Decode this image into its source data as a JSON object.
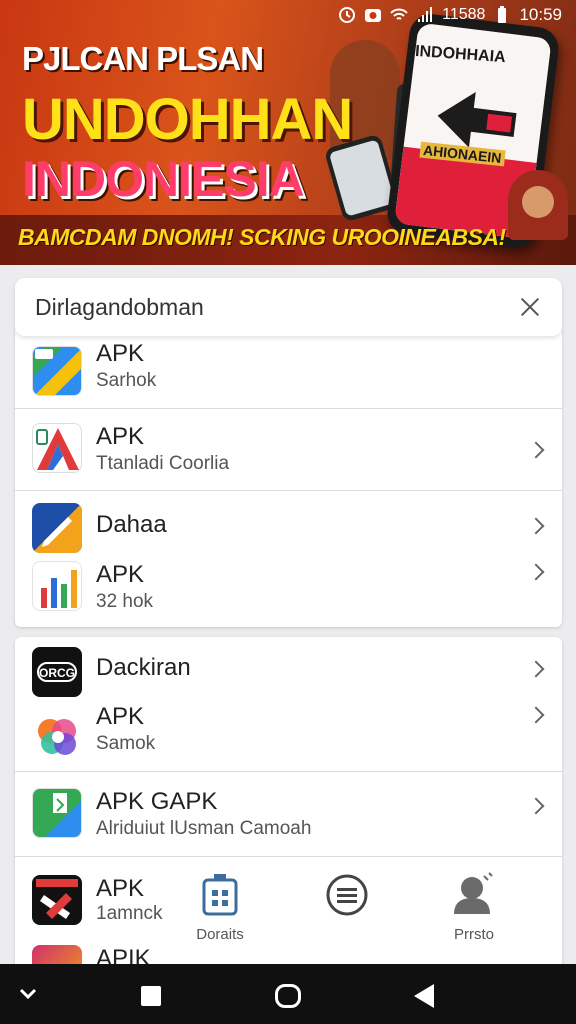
{
  "status_bar": {
    "time": "10:59",
    "signal_label": "11588"
  },
  "banner": {
    "line1": "PJLCAN PLSAN",
    "line2": "UNDOHHAN",
    "line3": "INDONIESIA",
    "tagline": "BAMCDAM DNOMH! SCKING UROOINEABSA!",
    "phone_title": "INDOHHAIA",
    "phone_sub": "AHIONAEIN"
  },
  "search": {
    "value": "Dirlagandobman"
  },
  "list_top": [
    {
      "title": "APK",
      "subtitle": "Sarhok",
      "chevron": false
    },
    {
      "title": "APK",
      "subtitle": "Ttanladi Coorlia",
      "chevron": true
    },
    {
      "title": "Dahaa",
      "subtitle": "",
      "chevron": true
    },
    {
      "title": "APK",
      "subtitle": "32 hok",
      "chevron": true
    }
  ],
  "list_bottom": [
    {
      "title": "Dackiran",
      "subtitle": "",
      "chevron": true
    },
    {
      "title": "APK",
      "subtitle": "Samok",
      "chevron": true
    },
    {
      "title": "APK GAPK",
      "subtitle": "Alriduiut lUsman Camoah",
      "chevron": true
    },
    {
      "title": "APK",
      "subtitle": "1amnck",
      "chevron": false
    },
    {
      "title": "APIK",
      "subtitle": "",
      "chevron": false
    }
  ],
  "bottom_tabs": [
    {
      "label": "Doraits",
      "icon": "building-icon"
    },
    {
      "label": "",
      "icon": "list-circle-icon"
    },
    {
      "label": "Prrsto",
      "icon": "profile-icon"
    }
  ],
  "icon_logo_text": "ORCG"
}
